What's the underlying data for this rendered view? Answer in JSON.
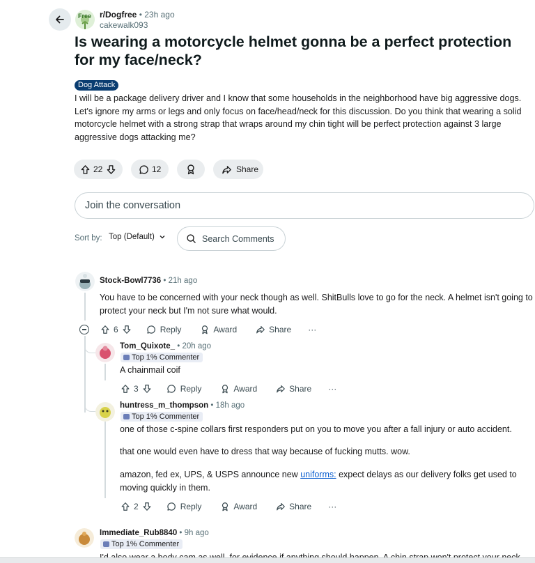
{
  "header": {
    "subreddit": "r/Dogfree",
    "separator": "•",
    "age": "23h ago",
    "author": "cakewalk093",
    "avatar_text": "Free"
  },
  "post": {
    "title": "Is wearing a motorcycle helmet gonna be a perfect protection for my face/neck?",
    "flair": "Dog Attack",
    "body": "I will be a package delivery driver and I know that some households in the neighborhood have big aggressive dogs. Let's ignore my arms or legs and only focus on face/head/neck for this discussion. Do you think that wearing a solid motorcycle helmet with a strong strap that wraps around my chin tight will be perfect protection against 3 large aggressive dogs attacking me?",
    "votes": "22",
    "comments": "12",
    "share": "Share"
  },
  "join": {
    "placeholder": "Join the conversation"
  },
  "sort": {
    "label": "Sort by:",
    "value": "Top (Default)"
  },
  "search": {
    "placeholder": "Search Comments"
  },
  "actions_labels": {
    "reply": "Reply",
    "award": "Award",
    "share": "Share",
    "more": "···"
  },
  "comments": [
    {
      "user": "Stock-Bowl7736",
      "age": "21h ago",
      "text": "You have to be concerned with your neck though as well. ShitBulls love to go for the neck. A helmet isn't going to protect your neck but I'm not sure what would.",
      "votes": "6"
    },
    {
      "user": "Tom_Quixote_",
      "age": "20h ago",
      "badge": "Top 1% Commenter",
      "text": "A chainmail coif",
      "votes": "3"
    },
    {
      "user": "huntress_m_thompson",
      "age": "18h ago",
      "badge": "Top 1% Commenter",
      "p1": "one of those c-spine collars first responders put on you to move you after a fall injury or auto accident.",
      "p2": "that one would even have to dress that way because of fucking mutts. wow.",
      "p3_before": "amazon, fed ex, UPS, & USPS announce new ",
      "p3_link": "uniforms:",
      "p3_after": " expect delays as our delivery folks get used to moving quickly in them.",
      "votes": "2"
    },
    {
      "user": "Immediate_Rub8840",
      "age": "9h ago",
      "badge": "Top 1% Commenter",
      "text": "I'd also wear a body cam as well, for evidence if anything should happen. A chin strap won't protect your neck..."
    }
  ]
}
